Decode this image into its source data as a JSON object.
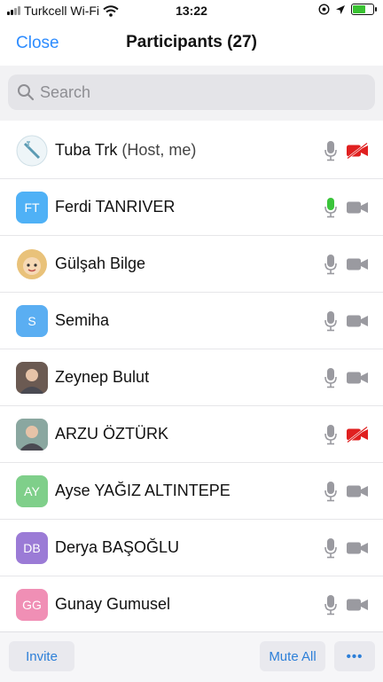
{
  "status_bar": {
    "carrier": "Turkcell Wi-Fi",
    "time": "13:22"
  },
  "header": {
    "close_label": "Close",
    "title": "Participants (27)"
  },
  "search": {
    "placeholder": "Search"
  },
  "participants": [
    {
      "name": "Tuba Trk",
      "tag": "(Host, me)",
      "avatar_type": "image",
      "avatar_icon": "seal-logo-icon",
      "mic": "muted",
      "camera": "off"
    },
    {
      "name": "Ferdi TANRIVER",
      "tag": "",
      "avatar_type": "initials",
      "initials": "FT",
      "avatar_color": "#4fb1f6",
      "mic": "active",
      "camera": "on"
    },
    {
      "name": "Gülşah Bilge",
      "tag": "",
      "avatar_type": "image",
      "avatar_icon": "emoji-avatar-icon",
      "mic": "muted",
      "camera": "on"
    },
    {
      "name": "Semiha",
      "tag": "",
      "avatar_type": "initials",
      "initials": "S",
      "avatar_color": "#5aaef2",
      "mic": "muted",
      "camera": "on"
    },
    {
      "name": "Zeynep Bulut",
      "tag": "",
      "avatar_type": "image",
      "avatar_icon": "photo-avatar-icon",
      "mic": "muted",
      "camera": "on"
    },
    {
      "name": "ARZU ÖZTÜRK",
      "tag": "",
      "avatar_type": "image",
      "avatar_icon": "photo-avatar-icon",
      "mic": "muted",
      "camera": "off"
    },
    {
      "name": "Ayse YAĞIZ ALTINTEPE",
      "tag": "",
      "avatar_type": "initials",
      "initials": "AY",
      "avatar_color": "#7fcf8a",
      "mic": "muted",
      "camera": "on"
    },
    {
      "name": "Derya BAŞOĞLU",
      "tag": "",
      "avatar_type": "initials",
      "initials": "DB",
      "avatar_color": "#9b7bd6",
      "mic": "muted",
      "camera": "on"
    },
    {
      "name": "Gunay Gumusel",
      "tag": "",
      "avatar_type": "initials",
      "initials": "GG",
      "avatar_color": "#f08fb5",
      "mic": "muted",
      "camera": "on"
    }
  ],
  "footer": {
    "invite_label": "Invite",
    "mute_all_label": "Mute All",
    "more_label": "•••"
  },
  "colors": {
    "accent": "#2d8cff",
    "mic_active": "#3ac43a",
    "camera_off": "#e02020",
    "icon_gray": "#9a9aa0"
  }
}
